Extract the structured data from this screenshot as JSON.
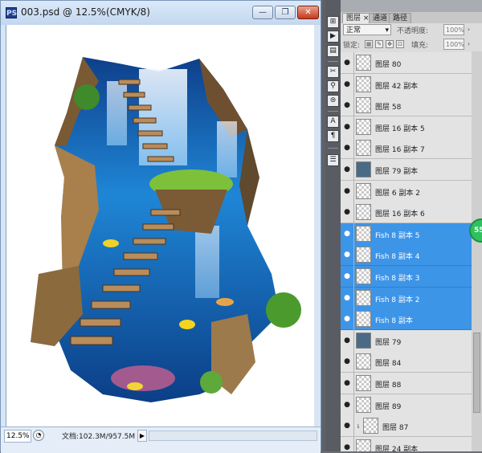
{
  "document": {
    "title": "003.psd @ 12.5%(CMYK/8)",
    "ps_icon": "PS",
    "controls": {
      "minimize": "—",
      "restore": "❐",
      "close": "✕"
    },
    "status": {
      "zoom": "12.5%",
      "doc_info": "文档:102.3M/957.5M",
      "arrow": "▶"
    }
  },
  "panel": {
    "tabs": [
      "图层",
      "通道",
      "路径"
    ],
    "tab_close": "×",
    "blend_mode": "正常",
    "opacity_label": "不透明度:",
    "opacity_value": "100%",
    "lock_label": "锁定:",
    "fill_label": "填充:",
    "fill_value": "100%",
    "layers": [
      {
        "name": "图层 80",
        "selected": false
      },
      {
        "name": "图层 42 副本",
        "selected": false
      },
      {
        "name": "图层 58",
        "selected": false
      },
      {
        "name": "图层 16 副本 5",
        "selected": false
      },
      {
        "name": "图层 16 副本 7",
        "selected": false
      },
      {
        "name": "图层 79 副本",
        "selected": false
      },
      {
        "name": "图层 6 副本 2",
        "selected": false
      },
      {
        "name": "图层 16 副本 6",
        "selected": false
      },
      {
        "name": "Fish 8 副本 5",
        "selected": true
      },
      {
        "name": "Fish 8 副本 4",
        "selected": true
      },
      {
        "name": "Fish 8 副本 3",
        "selected": true
      },
      {
        "name": "Fish 8 副本 2",
        "selected": true
      },
      {
        "name": "Fish 8 副本",
        "selected": true
      },
      {
        "name": "图层 79",
        "selected": false
      },
      {
        "name": "图层 84",
        "selected": false
      },
      {
        "name": "图层 88",
        "selected": false
      },
      {
        "name": "图层 89",
        "selected": false
      },
      {
        "name": "图层 87",
        "selected": false
      },
      {
        "name": "图层 24 副本",
        "selected": false
      }
    ]
  },
  "badge": "55",
  "colors": {
    "selection": "#3d95e8",
    "panel_bg": "#dcdcdc",
    "window_frame": "#d6e6f7",
    "water": "#1e7fd0"
  }
}
